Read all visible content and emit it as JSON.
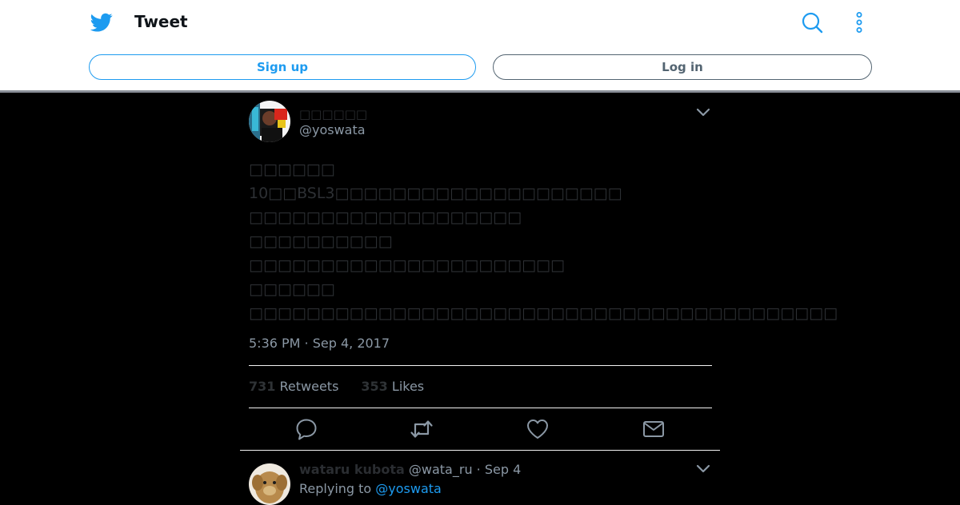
{
  "header": {
    "title": "Tweet",
    "signup_label": "Sign up",
    "login_label": "Log in",
    "brand_icon": "twitter-bird-icon",
    "search_icon": "search-icon",
    "more_icon": "more-vertical-icon"
  },
  "tweet": {
    "display_name": "□□□□□□",
    "handle": "@yoswata",
    "text_lines": [
      "□□□□□□",
      "10□□BSL3□□□□□□□□□□□□□□□□□□□□",
      "□□□□□□□□□□□□□□□□□□□",
      "□□□□□□□□□□",
      "□□□□□□□□□□□□□□□□□□□□□□",
      "□□□□□□",
      "□□□□□□□□□□□□□□□□□□□□□□□□□□□□□□□□□□□□□□□□□"
    ],
    "timestamp": "5:36 PM · Sep 4, 2017",
    "retweets_count": "731",
    "retweets_label": "Retweets",
    "likes_count": "353",
    "likes_label": "Likes"
  },
  "reply": {
    "name": "wataru kubota",
    "handle": "@wata_ru",
    "separator": " · ",
    "date": "Sep 4",
    "replying_prefix": "Replying to ",
    "replying_to": "@yoswata"
  },
  "colors": {
    "accent": "#1d9bf0",
    "background": "#000000",
    "header_bg": "#ffffff",
    "muted_text": "#8b98a5"
  }
}
